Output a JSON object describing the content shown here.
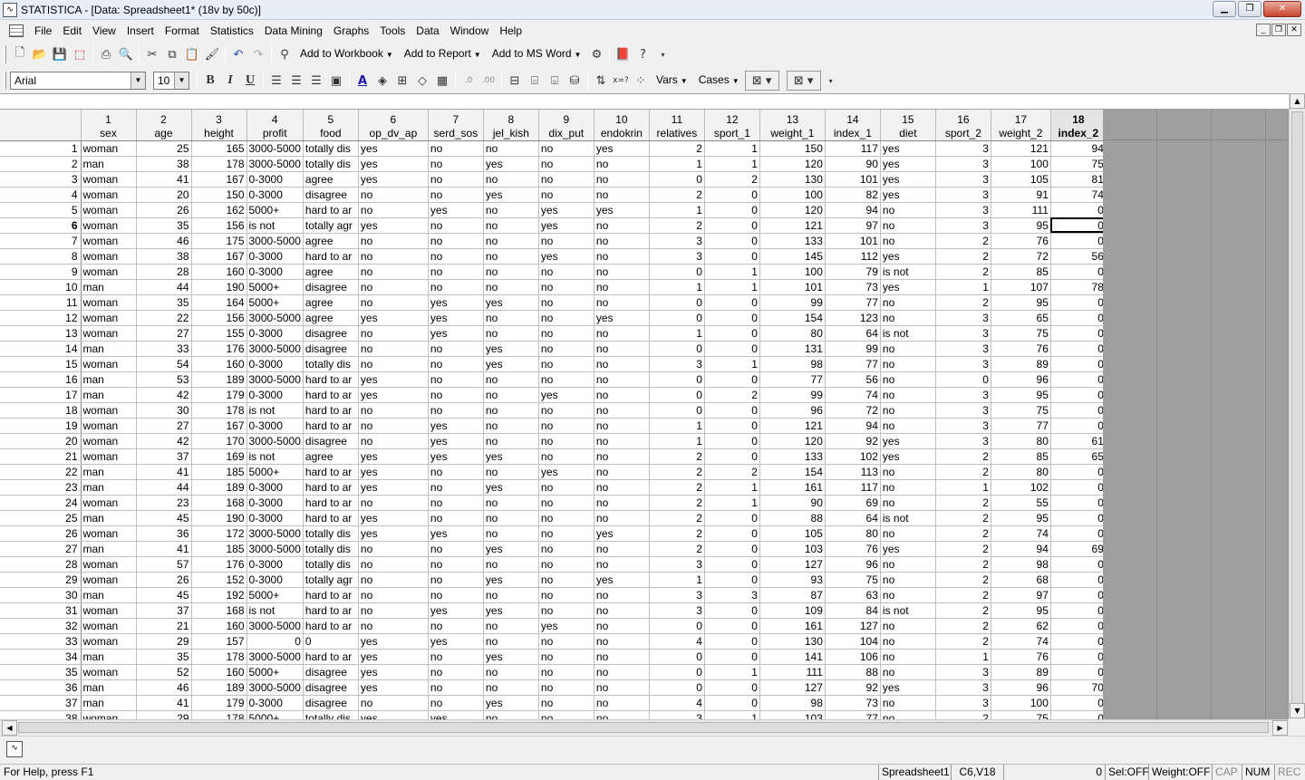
{
  "window": {
    "title": "STATISTICA - [Data: Spreadsheet1* (18v by 50c)]"
  },
  "menu": [
    "File",
    "Edit",
    "View",
    "Insert",
    "Format",
    "Statistics",
    "Data Mining",
    "Graphs",
    "Tools",
    "Data",
    "Window",
    "Help"
  ],
  "toolbar1": {
    "add_to_workbook": "Add to Workbook",
    "add_to_report": "Add to Report",
    "add_to_ms_word": "Add to MS Word"
  },
  "toolbar2": {
    "font": "Arial",
    "size": "10",
    "vars": "Vars",
    "cases": "Cases"
  },
  "columns": [
    {
      "n": "1",
      "name": "sex",
      "w": 61
    },
    {
      "n": "2",
      "name": "age",
      "w": 61
    },
    {
      "n": "3",
      "name": "height",
      "w": 61
    },
    {
      "n": "4",
      "name": "profit",
      "w": 61
    },
    {
      "n": "5",
      "name": "food",
      "w": 61
    },
    {
      "n": "6",
      "name": "op_dv_ap",
      "w": 77
    },
    {
      "n": "7",
      "name": "serd_sos",
      "w": 61
    },
    {
      "n": "8",
      "name": "jel_kish",
      "w": 61
    },
    {
      "n": "9",
      "name": "dix_put",
      "w": 61
    },
    {
      "n": "10",
      "name": "endokrin",
      "w": 61
    },
    {
      "n": "11",
      "name": "relatives",
      "w": 61
    },
    {
      "n": "12",
      "name": "sport_1",
      "w": 61
    },
    {
      "n": "13",
      "name": "weight_1",
      "w": 72
    },
    {
      "n": "14",
      "name": "index_1",
      "w": 61
    },
    {
      "n": "15",
      "name": "diet",
      "w": 61
    },
    {
      "n": "16",
      "name": "sport_2",
      "w": 61
    },
    {
      "n": "17",
      "name": "weight_2",
      "w": 66
    },
    {
      "n": "18",
      "name": "index_2",
      "w": 61
    }
  ],
  "numeric_cols": [
    1,
    2,
    10,
    11,
    12,
    13,
    15,
    16,
    17
  ],
  "rows": [
    [
      "woman",
      "25",
      "165",
      "3000-5000",
      "totally dis",
      "yes",
      "no",
      "no",
      "no",
      "yes",
      "2",
      "1",
      "150",
      "117",
      "yes",
      "3",
      "121",
      "94"
    ],
    [
      "man",
      "38",
      "178",
      "3000-5000",
      "totally dis",
      "yes",
      "no",
      "yes",
      "no",
      "no",
      "1",
      "1",
      "120",
      "90",
      "yes",
      "3",
      "100",
      "75"
    ],
    [
      "woman",
      "41",
      "167",
      "0-3000",
      "agree",
      "yes",
      "no",
      "no",
      "no",
      "no",
      "0",
      "2",
      "130",
      "101",
      "yes",
      "3",
      "105",
      "81"
    ],
    [
      "woman",
      "20",
      "150",
      "0-3000",
      "disagree",
      "no",
      "no",
      "yes",
      "no",
      "no",
      "2",
      "0",
      "100",
      "82",
      "yes",
      "3",
      "91",
      "74"
    ],
    [
      "woman",
      "26",
      "162",
      "5000+",
      "hard to ar",
      "no",
      "yes",
      "no",
      "yes",
      "yes",
      "1",
      "0",
      "120",
      "94",
      "no",
      "3",
      "111",
      "0"
    ],
    [
      "woman",
      "35",
      "156",
      "is not",
      "totally agr",
      "yes",
      "no",
      "no",
      "yes",
      "no",
      "2",
      "0",
      "121",
      "97",
      "no",
      "3",
      "95",
      "0"
    ],
    [
      "woman",
      "46",
      "175",
      "3000-5000",
      "agree",
      "no",
      "no",
      "no",
      "no",
      "no",
      "3",
      "0",
      "133",
      "101",
      "no",
      "2",
      "76",
      "0"
    ],
    [
      "woman",
      "38",
      "167",
      "0-3000",
      "hard to ar",
      "no",
      "no",
      "no",
      "yes",
      "no",
      "3",
      "0",
      "145",
      "112",
      "yes",
      "2",
      "72",
      "56"
    ],
    [
      "woman",
      "28",
      "160",
      "0-3000",
      "agree",
      "no",
      "no",
      "no",
      "no",
      "no",
      "0",
      "1",
      "100",
      "79",
      "is not",
      "2",
      "85",
      "0"
    ],
    [
      "man",
      "44",
      "190",
      "5000+",
      "disagree",
      "no",
      "no",
      "no",
      "no",
      "no",
      "1",
      "1",
      "101",
      "73",
      "yes",
      "1",
      "107",
      "78"
    ],
    [
      "woman",
      "35",
      "164",
      "5000+",
      "agree",
      "no",
      "yes",
      "yes",
      "no",
      "no",
      "0",
      "0",
      "99",
      "77",
      "no",
      "2",
      "95",
      "0"
    ],
    [
      "woman",
      "22",
      "156",
      "3000-5000",
      "agree",
      "yes",
      "yes",
      "no",
      "no",
      "yes",
      "0",
      "0",
      "154",
      "123",
      "no",
      "3",
      "65",
      "0"
    ],
    [
      "woman",
      "27",
      "155",
      "0-3000",
      "disagree",
      "no",
      "yes",
      "no",
      "no",
      "no",
      "1",
      "0",
      "80",
      "64",
      "is not",
      "3",
      "75",
      "0"
    ],
    [
      "man",
      "33",
      "176",
      "3000-5000",
      "disagree",
      "no",
      "no",
      "yes",
      "no",
      "no",
      "0",
      "0",
      "131",
      "99",
      "no",
      "3",
      "76",
      "0"
    ],
    [
      "woman",
      "54",
      "160",
      "0-3000",
      "totally dis",
      "no",
      "no",
      "yes",
      "no",
      "no",
      "3",
      "1",
      "98",
      "77",
      "no",
      "3",
      "89",
      "0"
    ],
    [
      "man",
      "53",
      "189",
      "3000-5000",
      "hard to ar",
      "yes",
      "no",
      "no",
      "no",
      "no",
      "0",
      "0",
      "77",
      "56",
      "no",
      "0",
      "96",
      "0"
    ],
    [
      "man",
      "42",
      "179",
      "0-3000",
      "hard to ar",
      "yes",
      "no",
      "no",
      "yes",
      "no",
      "0",
      "2",
      "99",
      "74",
      "no",
      "3",
      "95",
      "0"
    ],
    [
      "woman",
      "30",
      "178",
      "is not",
      "hard to ar",
      "no",
      "no",
      "no",
      "no",
      "no",
      "0",
      "0",
      "96",
      "72",
      "no",
      "3",
      "75",
      "0"
    ],
    [
      "woman",
      "27",
      "167",
      "0-3000",
      "hard to ar",
      "no",
      "yes",
      "no",
      "no",
      "no",
      "1",
      "0",
      "121",
      "94",
      "no",
      "3",
      "77",
      "0"
    ],
    [
      "woman",
      "42",
      "170",
      "3000-5000",
      "disagree",
      "no",
      "yes",
      "no",
      "no",
      "no",
      "1",
      "0",
      "120",
      "92",
      "yes",
      "3",
      "80",
      "61"
    ],
    [
      "woman",
      "37",
      "169",
      "is not",
      "agree",
      "yes",
      "yes",
      "yes",
      "no",
      "no",
      "2",
      "0",
      "133",
      "102",
      "yes",
      "2",
      "85",
      "65"
    ],
    [
      "man",
      "41",
      "185",
      "5000+",
      "hard to ar",
      "yes",
      "no",
      "no",
      "yes",
      "no",
      "2",
      "2",
      "154",
      "113",
      "no",
      "2",
      "80",
      "0"
    ],
    [
      "man",
      "44",
      "189",
      "0-3000",
      "hard to ar",
      "yes",
      "no",
      "yes",
      "no",
      "no",
      "2",
      "1",
      "161",
      "117",
      "no",
      "1",
      "102",
      "0"
    ],
    [
      "woman",
      "23",
      "168",
      "0-3000",
      "hard to ar",
      "no",
      "no",
      "no",
      "no",
      "no",
      "2",
      "1",
      "90",
      "69",
      "no",
      "2",
      "55",
      "0"
    ],
    [
      "man",
      "45",
      "190",
      "0-3000",
      "hard to ar",
      "yes",
      "no",
      "no",
      "no",
      "no",
      "2",
      "0",
      "88",
      "64",
      "is not",
      "2",
      "95",
      "0"
    ],
    [
      "woman",
      "36",
      "172",
      "3000-5000",
      "totally dis",
      "yes",
      "yes",
      "no",
      "no",
      "yes",
      "2",
      "0",
      "105",
      "80",
      "no",
      "2",
      "74",
      "0"
    ],
    [
      "man",
      "41",
      "185",
      "3000-5000",
      "totally dis",
      "no",
      "no",
      "yes",
      "no",
      "no",
      "2",
      "0",
      "103",
      "76",
      "yes",
      "2",
      "94",
      "69"
    ],
    [
      "woman",
      "57",
      "176",
      "0-3000",
      "totally dis",
      "no",
      "no",
      "no",
      "no",
      "no",
      "3",
      "0",
      "127",
      "96",
      "no",
      "2",
      "98",
      "0"
    ],
    [
      "woman",
      "26",
      "152",
      "0-3000",
      "totally agr",
      "no",
      "no",
      "yes",
      "no",
      "yes",
      "1",
      "0",
      "93",
      "75",
      "no",
      "2",
      "68",
      "0"
    ],
    [
      "man",
      "45",
      "192",
      "5000+",
      "hard to ar",
      "no",
      "no",
      "no",
      "no",
      "no",
      "3",
      "3",
      "87",
      "63",
      "no",
      "2",
      "97",
      "0"
    ],
    [
      "woman",
      "37",
      "168",
      "is not",
      "hard to ar",
      "no",
      "yes",
      "yes",
      "no",
      "no",
      "3",
      "0",
      "109",
      "84",
      "is not",
      "2",
      "95",
      "0"
    ],
    [
      "woman",
      "21",
      "160",
      "3000-5000",
      "hard to ar",
      "no",
      "no",
      "no",
      "yes",
      "no",
      "0",
      "0",
      "161",
      "127",
      "no",
      "2",
      "62",
      "0"
    ],
    [
      "woman",
      "29",
      "157",
      "0",
      "0",
      "yes",
      "yes",
      "no",
      "no",
      "no",
      "4",
      "0",
      "130",
      "104",
      "no",
      "2",
      "74",
      "0"
    ],
    [
      "man",
      "35",
      "178",
      "3000-5000",
      "hard to ar",
      "yes",
      "no",
      "yes",
      "no",
      "no",
      "0",
      "0",
      "141",
      "106",
      "no",
      "1",
      "76",
      "0"
    ],
    [
      "woman",
      "52",
      "160",
      "5000+",
      "disagree",
      "yes",
      "no",
      "no",
      "no",
      "no",
      "0",
      "1",
      "111",
      "88",
      "no",
      "3",
      "89",
      "0"
    ],
    [
      "man",
      "46",
      "189",
      "3000-5000",
      "disagree",
      "yes",
      "no",
      "no",
      "no",
      "no",
      "0",
      "0",
      "127",
      "92",
      "yes",
      "3",
      "96",
      "70"
    ],
    [
      "man",
      "41",
      "179",
      "0-3000",
      "disagree",
      "no",
      "no",
      "yes",
      "no",
      "no",
      "4",
      "0",
      "98",
      "73",
      "no",
      "3",
      "100",
      "0"
    ],
    [
      "woman",
      "29",
      "178",
      "5000+",
      "totally dis",
      "yes",
      "yes",
      "no",
      "no",
      "no",
      "3",
      "1",
      "103",
      "77",
      "no",
      "2",
      "75",
      "0"
    ]
  ],
  "row33_col3_as_number": true,
  "selection": {
    "row": 6,
    "col": 18
  },
  "sheet_tab": "Spreadsheet1",
  "status": {
    "help": "For Help, press F1",
    "sheet": "Spreadsheet1",
    "cell": "C6,V18",
    "value": "0",
    "sel": "Sel:OFF",
    "weight": "Weight:OFF",
    "cap": "CAP",
    "num": "NUM",
    "rec": "REC"
  }
}
